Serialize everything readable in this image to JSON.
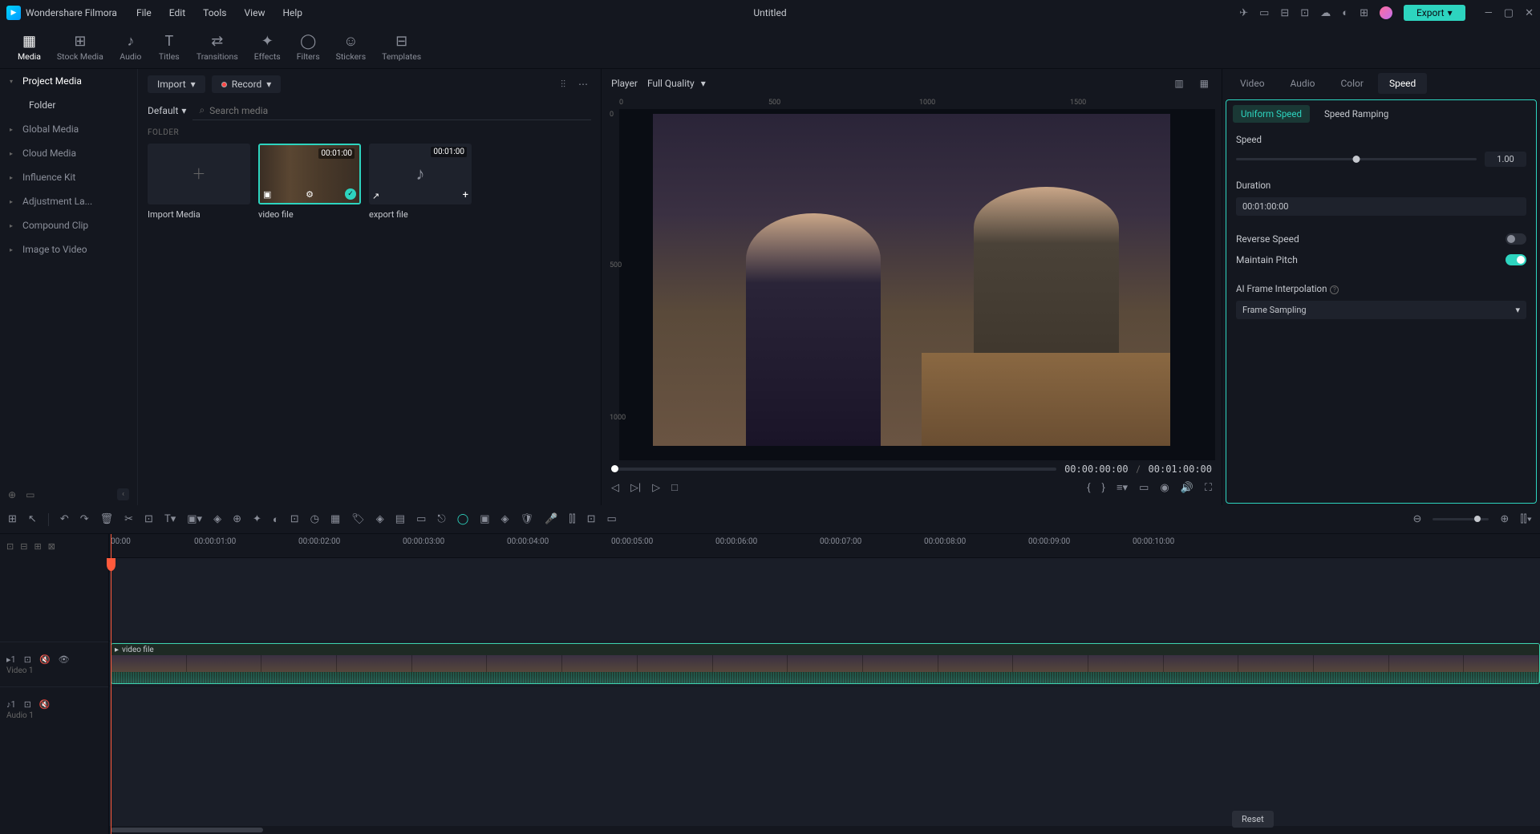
{
  "app": {
    "name": "Wondershare Filmora",
    "title": "Untitled"
  },
  "menu": [
    "File",
    "Edit",
    "Tools",
    "View",
    "Help"
  ],
  "export_label": "Export",
  "tool_tabs": [
    {
      "icon": "▦",
      "label": "Media",
      "active": true
    },
    {
      "icon": "⊞",
      "label": "Stock Media"
    },
    {
      "icon": "♪",
      "label": "Audio"
    },
    {
      "icon": "T",
      "label": "Titles"
    },
    {
      "icon": "⇄",
      "label": "Transitions"
    },
    {
      "icon": "✦",
      "label": "Effects"
    },
    {
      "icon": "◯",
      "label": "Filters"
    },
    {
      "icon": "☺",
      "label": "Stickers"
    },
    {
      "icon": "⊟",
      "label": "Templates"
    }
  ],
  "sidebar": {
    "items": [
      {
        "label": "Project Media",
        "active": true,
        "sub": "Folder"
      },
      {
        "label": "Global Media"
      },
      {
        "label": "Cloud Media"
      },
      {
        "label": "Influence Kit"
      },
      {
        "label": "Adjustment La..."
      },
      {
        "label": "Compound Clip"
      },
      {
        "label": "Image to Video"
      }
    ]
  },
  "media": {
    "import_label": "Import",
    "record_label": "Record",
    "default_label": "Default",
    "search_placeholder": "Search media",
    "folder_label": "FOLDER",
    "cards": [
      {
        "name": "Import Media",
        "type": "import"
      },
      {
        "name": "video file",
        "type": "video",
        "dur": "00:01:00",
        "selected": true
      },
      {
        "name": "export file",
        "type": "audio",
        "dur": "00:01:00"
      }
    ]
  },
  "player": {
    "label": "Player",
    "quality": "Full Quality",
    "ruler_h": [
      "0",
      "500",
      "1000",
      "1500"
    ],
    "ruler_v": [
      "0",
      "500",
      "1000"
    ],
    "current": "00:00:00:00",
    "total": "00:01:00:00"
  },
  "props": {
    "tabs": [
      "Video",
      "Audio",
      "Color",
      "Speed"
    ],
    "active_tab": "Speed",
    "sub_tabs": [
      "Uniform Speed",
      "Speed Ramping"
    ],
    "active_sub": "Uniform Speed",
    "speed_label": "Speed",
    "speed_value": "1.00",
    "duration_label": "Duration",
    "duration_value": "00:01:00:00",
    "reverse_label": "Reverse Speed",
    "pitch_label": "Maintain Pitch",
    "interp_label": "AI Frame Interpolation",
    "interp_value": "Frame Sampling",
    "reset_label": "Reset"
  },
  "timeline": {
    "ruler": [
      "00:00",
      "00:00:01:00",
      "00:00:02:00",
      "00:00:03:00",
      "00:00:04:00",
      "00:00:05:00",
      "00:00:06:00",
      "00:00:07:00",
      "00:00:08:00",
      "00:00:09:00",
      "00:00:10:00"
    ],
    "tracks": [
      {
        "name": "Video 1",
        "icons": [
          "▸",
          "⊡",
          "👁",
          "◉"
        ]
      },
      {
        "name": "Audio 1",
        "icons": [
          "♪",
          "⊡",
          "🔇"
        ]
      }
    ],
    "clip_name": "video file"
  }
}
